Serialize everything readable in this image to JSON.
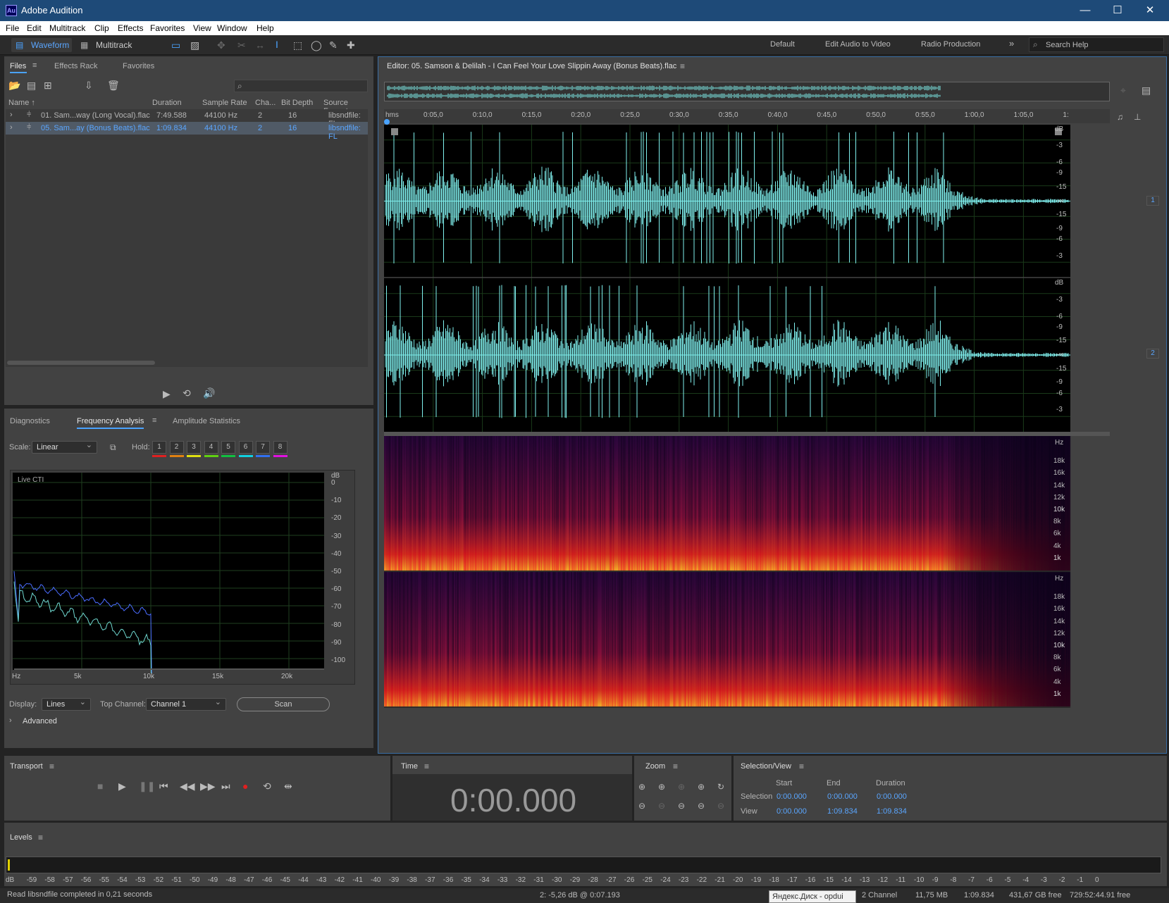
{
  "app": {
    "title": "Adobe Audition",
    "logo": "Au"
  },
  "menu": [
    "File",
    "Edit",
    "Multitrack",
    "Clip",
    "Effects",
    "Favorites",
    "View",
    "Window",
    "Help"
  ],
  "toolbar": {
    "waveform": "Waveform",
    "multitrack": "Multitrack",
    "workspaces": [
      "Default",
      "Edit Audio to Video",
      "Radio Production"
    ],
    "search_placeholder": "Search Help"
  },
  "files_panel": {
    "tabs": [
      "Files",
      "Effects Rack",
      "Favorites"
    ],
    "columns": [
      "Name",
      "Duration",
      "Sample Rate",
      "Cha...",
      "Bit Depth",
      "Source Format"
    ],
    "rows": [
      {
        "name": "01. Sam...way (Long Vocal).flac",
        "duration": "7:49.588",
        "rate": "44100 Hz",
        "ch": "2",
        "bits": "16",
        "fmt": "libsndfile: FL"
      },
      {
        "name": "05. Sam...ay (Bonus Beats).flac",
        "duration": "1:09.834",
        "rate": "44100 Hz",
        "ch": "2",
        "bits": "16",
        "fmt": "libsndfile: FL"
      }
    ]
  },
  "analysis": {
    "tabs": [
      "Diagnostics",
      "Frequency Analysis",
      "Amplitude Statistics"
    ],
    "scale_label": "Scale:",
    "scale_value": "Linear",
    "hold_label": "Hold:",
    "holds": [
      "1",
      "2",
      "3",
      "4",
      "5",
      "6",
      "7",
      "8"
    ],
    "hold_colors": [
      "#e02020",
      "#e08010",
      "#e0e010",
      "#60d010",
      "#10c040",
      "#10d0e0",
      "#3070f0",
      "#e010e0"
    ],
    "live_label": "Live CTI",
    "db_unit": "dB",
    "db_ticks": [
      "0",
      "-10",
      "-20",
      "-30",
      "-40",
      "-50",
      "-60",
      "-70",
      "-80",
      "-90",
      "-100"
    ],
    "hz_ticks": [
      "Hz",
      "5k",
      "10k",
      "15k",
      "20k"
    ],
    "display_label": "Display:",
    "display_value": "Lines",
    "top_channel_label": "Top Channel:",
    "top_channel_value": "Channel 1",
    "scan": "Scan",
    "advanced": "Advanced"
  },
  "editor": {
    "title": "Editor: 05. Samson & Delilah - I Can Feel Your Love Slippin Away (Bonus Beats).flac",
    "timeline": [
      "hms",
      "0:05,0",
      "0:10,0",
      "0:15,0",
      "0:20,0",
      "0:25,0",
      "0:30,0",
      "0:35,0",
      "0:40,0",
      "0:45,0",
      "0:50,0",
      "0:55,0",
      "1:00,0",
      "1:05,0",
      "1:"
    ],
    "db_scale": [
      "dB",
      "-3",
      "-6",
      "-9",
      "-15",
      "-∞",
      "-15",
      "-9",
      "-6",
      "-3"
    ],
    "hz_scale": [
      "Hz",
      "18k",
      "16k",
      "14k",
      "12k",
      "10k",
      "8k",
      "6k",
      "4k",
      "1k"
    ],
    "ch1": "1",
    "ch2": "2",
    "waveform_color": "#7ff0ee"
  },
  "transport": {
    "title": "Transport"
  },
  "time": {
    "title": "Time",
    "value": "0:00.000"
  },
  "zoom": {
    "title": "Zoom"
  },
  "selection": {
    "title": "Selection/View",
    "cols": [
      "Start",
      "End",
      "Duration"
    ],
    "rows": [
      {
        "label": "Selection",
        "start": "0:00.000",
        "end": "0:00.000",
        "dur": "0:00.000"
      },
      {
        "label": "View",
        "start": "0:00.000",
        "end": "1:09.834",
        "dur": "1:09.834"
      }
    ]
  },
  "levels": {
    "title": "Levels",
    "scale": [
      "dB",
      "-59",
      "-58",
      "-57",
      "-56",
      "-55",
      "-54",
      "-53",
      "-52",
      "-51",
      "-50",
      "-49",
      "-48",
      "-47",
      "-46",
      "-45",
      "-44",
      "-43",
      "-42",
      "-41",
      "-40",
      "-39",
      "-38",
      "-37",
      "-36",
      "-35",
      "-34",
      "-33",
      "-32",
      "-31",
      "-30",
      "-29",
      "-28",
      "-27",
      "-26",
      "-25",
      "-24",
      "-23",
      "-22",
      "-21",
      "-20",
      "-19",
      "-18",
      "-17",
      "-16",
      "-15",
      "-14",
      "-13",
      "-12",
      "-11",
      "-10",
      "-9",
      "-8",
      "-7",
      "-6",
      "-5",
      "-4",
      "-3",
      "-2",
      "-1",
      "0"
    ]
  },
  "status": {
    "left": "Read libsndfile completed in 0,21 seconds",
    "cursor": "2: -5,26 dB @ 0:07.193",
    "tooltip": "Яндекс.Диск - opdui",
    "channels": "2 Channel",
    "size": "11,75 MB",
    "duration": "1:09.834",
    "free": "431,67 GB free",
    "free_time": "729:52:44.91 free"
  }
}
